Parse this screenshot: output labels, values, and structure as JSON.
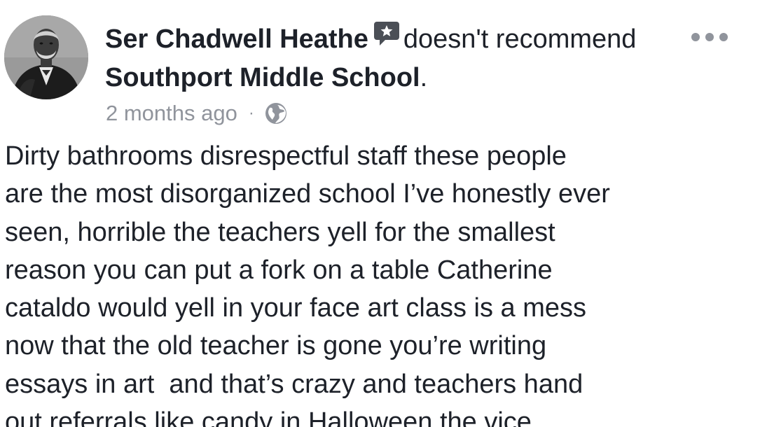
{
  "post": {
    "author_name": "Ser Chadwell Heathe",
    "action_text": "doesn't recommend",
    "place_name": "Southport Middle School",
    "period": ".",
    "timestamp": "2 months ago",
    "separator": "·",
    "privacy_icon": "globe-icon",
    "recommendation_icon": "speech-bubble-star-icon",
    "more_icon": "more-options-icon",
    "avatar": "profile-photo"
  },
  "review": {
    "lines": [
      "Dirty bathrooms disrespectful staff these people",
      "are the most disorganized school I’ve honestly ever",
      "seen, horrible the teachers yell for the smallest",
      "reason you can put a fork on a table Catherine",
      "cataldo would yell in your face art class is a mess",
      "now that the old teacher is gone you’re writing",
      "essays in art  and that’s crazy and teachers hand",
      "out referrals like candy in Halloween the vice"
    ]
  },
  "colors": {
    "text_primary": "#1d2129",
    "text_secondary": "#90949c",
    "icon_gray": "#90949c",
    "background": "#ffffff"
  }
}
